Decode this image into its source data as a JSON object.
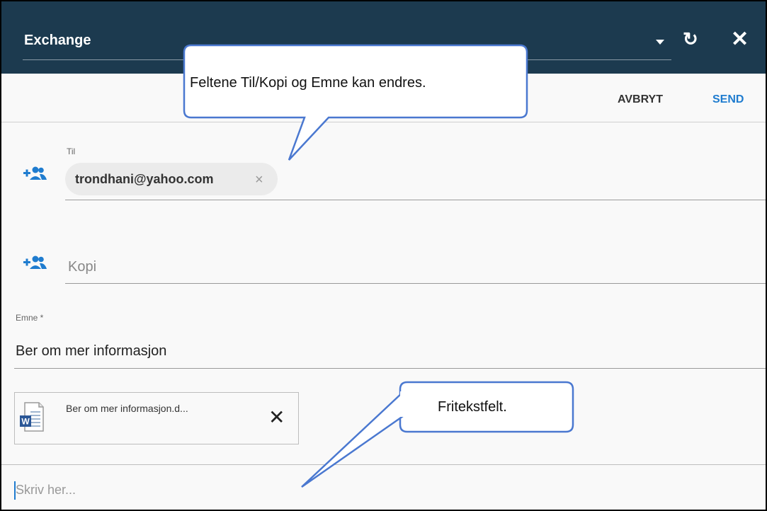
{
  "header": {
    "title": "Exchange",
    "refresh_icon": "refresh-icon",
    "close_icon": "close-icon",
    "dropdown_icon": "caret-down-icon"
  },
  "actions": {
    "cancel_label": "AVBRYT",
    "send_label": "SEND"
  },
  "to_field": {
    "label": "Til",
    "recipient": "trondhani@yahoo.com",
    "remove_glyph": "×"
  },
  "cc_field": {
    "placeholder": "Kopi"
  },
  "subject": {
    "label": "Emne *",
    "value": "Ber om mer informasjon"
  },
  "attachment": {
    "name": "Ber om mer informasjon.d...",
    "remove_glyph": "✕",
    "icon": "word-document-icon"
  },
  "body": {
    "placeholder": "Skriv her..."
  },
  "callouts": {
    "editable_fields": "Feltene Til/Kopi og Emne kan endres.",
    "free_text": "Fritekstfelt."
  },
  "colors": {
    "header_bg": "#1c3a4f",
    "accent": "#1f7ccf"
  }
}
